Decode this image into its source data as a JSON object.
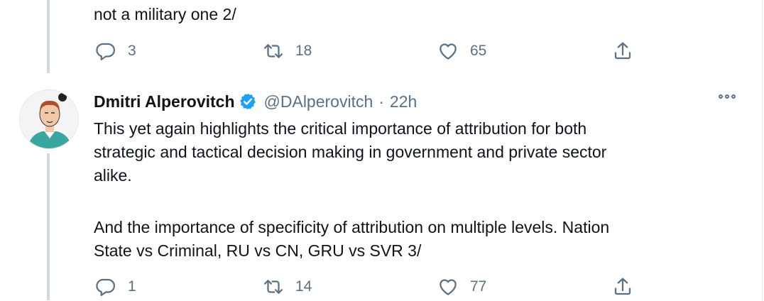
{
  "prev_tweet": {
    "text_tail": "not a military one 2/",
    "actions": {
      "reply": "3",
      "retweet": "18",
      "like": "65"
    }
  },
  "tweet": {
    "name": "Dmitri Alperovitch",
    "handle": "@DAlperovitch",
    "separator": "·",
    "time": "22h",
    "paragraph1": "This yet again highlights the critical importance of attribution for both\nstrategic and tactical decision making in government and private sector\nalike.",
    "paragraph2": "And the importance of specificity of attribution on multiple levels. Nation\nState vs Criminal, RU vs CN, GRU vs SVR 3/",
    "actions": {
      "reply": "1",
      "retweet": "14",
      "like": "77"
    }
  },
  "colors": {
    "verified": "#1da1f2",
    "secondary": "#5b7083",
    "thread_line": "#cfd9de"
  }
}
